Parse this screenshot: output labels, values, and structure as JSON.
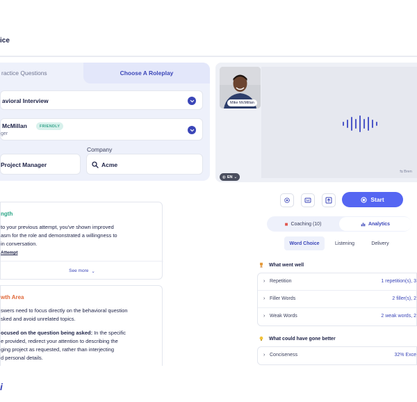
{
  "header": {
    "title": "ice"
  },
  "tabs": {
    "practice": "ractice Questions",
    "roleplay": "Choose A Roleplay"
  },
  "interview_select": {
    "value": "avioral Interview"
  },
  "person_select": {
    "name": "McMillan",
    "badge": "FRIENDLY",
    "role": "ger"
  },
  "role_input": {
    "value": "Project Manager"
  },
  "company": {
    "label": "Company",
    "value": "Acme"
  },
  "video": {
    "participant_name": "Mike McMillan",
    "language": "EN",
    "branding": "Bren"
  },
  "controls": {
    "start_label": "Start"
  },
  "coaching_tabs": {
    "coaching": "Coaching (10)",
    "analytics": "Analytics"
  },
  "sub_tabs": {
    "word_choice": "Word Choice",
    "listening": "Listening",
    "delivery": "Delivery"
  },
  "went_well": {
    "title": "What went well",
    "metrics": [
      {
        "label": "Repetition",
        "value": "1 repetition(s), 3"
      },
      {
        "label": "Filler Words",
        "value": "2 filler(s), 2"
      },
      {
        "label": "Weak Words",
        "value": "2 weak words, 2"
      }
    ]
  },
  "could_better": {
    "title": "What could have gone better",
    "metrics": [
      {
        "label": "Conciseness",
        "value": "32% Exce"
      }
    ]
  },
  "strength": {
    "heading": "ngth",
    "lines": [
      " to your previous attempt, you've shown improved",
      "asm for the role and demonstrated a willingness to",
      "in conversation."
    ],
    "link": "Attempt",
    "see_more": "See more"
  },
  "growth": {
    "heading": "wth Area",
    "lines": [
      "swers need to focus directly on the behavioral question",
      "sked and avoid unrelated topics."
    ],
    "bold_lead": "ocused on the question being asked:",
    "bold_tail": " In the specific",
    "lines2": [
      "e provided, redirect your attention to describing the",
      "ging project as requested, rather than interjecting",
      "d personal details."
    ]
  },
  "logo": {
    "text": "i"
  }
}
